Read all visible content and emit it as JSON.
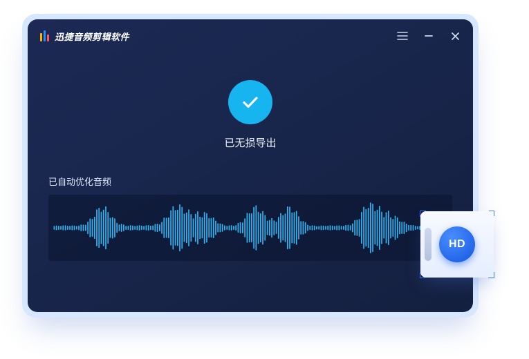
{
  "app": {
    "title": "迅捷音频剪辑软件"
  },
  "status": {
    "text": "已无损导出"
  },
  "section": {
    "label": "已自动优化音频"
  },
  "badge": {
    "hd": "HD"
  }
}
